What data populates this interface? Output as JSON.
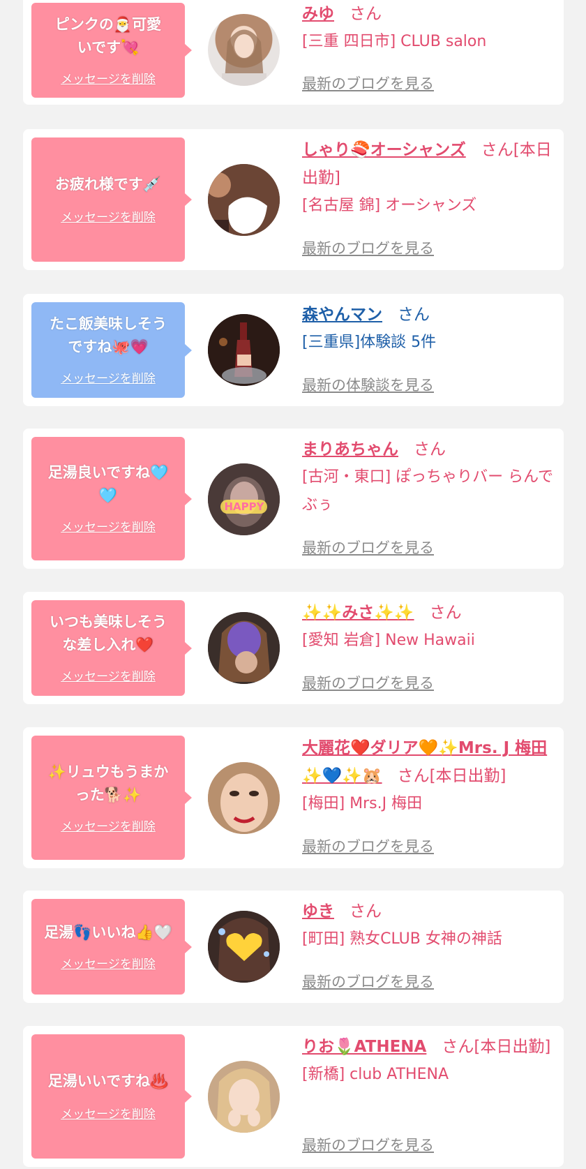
{
  "cards": [
    {
      "message": "ピンクの🎅可愛いです💘",
      "delete_label": "メッセージを削除",
      "bubble_color": "pink",
      "name": "みゆ",
      "name_suffix": "さん",
      "shop": "[三重 四日市] CLUB salon",
      "link": "最新のブログを見る",
      "text_color": "pink"
    },
    {
      "message": "お疲れ様です💉",
      "delete_label": "メッセージを削除",
      "bubble_color": "pink",
      "name": "しゃり🍣オーシャンズ",
      "name_suffix": "さん[本日出勤]",
      "shop": "[名古屋 錦] オーシャンズ",
      "link": "最新のブログを見る",
      "text_color": "pink"
    },
    {
      "message": "たこ飯美味しそうですね🐙💗",
      "delete_label": "メッセージを削除",
      "bubble_color": "blue",
      "name": "森やんマン",
      "name_suffix": "さん",
      "shop": "[三重県]体験談 5件",
      "link": "最新の体験談を見る",
      "text_color": "blue"
    },
    {
      "message": "足湯良いですね🩵🩵",
      "delete_label": "メッセージを削除",
      "bubble_color": "pink",
      "name": "まりあちゃん",
      "name_suffix": "さん",
      "shop": "[古河・東口] ぽっちゃりバー らんでぶぅ",
      "link": "最新のブログを見る",
      "text_color": "pink"
    },
    {
      "message": "いつも美味しそうな差し入れ❤️",
      "delete_label": "メッセージを削除",
      "bubble_color": "pink",
      "name": "✨✨みさ✨✨",
      "name_suffix": "さん",
      "shop": "[愛知 岩倉] New Hawaii",
      "link": "最新のブログを見る",
      "text_color": "pink"
    },
    {
      "message": "✨リュウもうまかった🐕✨",
      "delete_label": "メッセージを削除",
      "bubble_color": "pink",
      "name": "大麗花❤️ダリア🧡✨Mrs. J 梅田✨💙✨🐹",
      "name_suffix": "さん[本日出勤]",
      "shop": "[梅田] Mrs.J 梅田",
      "link": "最新のブログを見る",
      "text_color": "pink"
    },
    {
      "message": "足湯👣いいね👍🤍",
      "delete_label": "メッセージを削除",
      "bubble_color": "pink",
      "name": "ゆき",
      "name_suffix": "さん",
      "shop": "[町田] 熟女CLUB 女神の神話",
      "link": "最新のブログを見る",
      "text_color": "pink"
    },
    {
      "message": "足湯いいですね♨️",
      "delete_label": "メッセージを削除",
      "bubble_color": "pink",
      "name": "りお🌷ATHENA",
      "name_suffix": "さん[本日出勤]",
      "shop": "[新橋] club ATHENA",
      "link": "最新のブログを見る",
      "text_color": "pink"
    }
  ],
  "colors": {
    "pink_bubble": "#ff8fa0",
    "blue_bubble": "#8fb8f5",
    "pink_text": "#e24b6e",
    "blue_text": "#1e5fa8",
    "link_gray": "#8a8a8a",
    "background": "#f2f2f2"
  }
}
